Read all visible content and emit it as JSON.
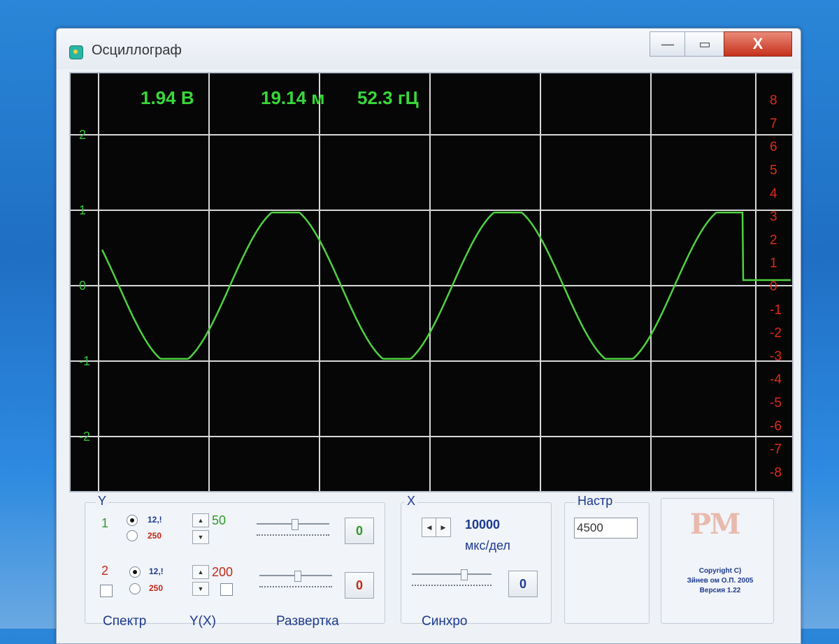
{
  "window": {
    "title": "Осциллограф",
    "min": "—",
    "max": "▭",
    "close": "X"
  },
  "readouts": {
    "voltage": "1.94 В",
    "period": "19.14 м",
    "frequency": "52.3 гЦ"
  },
  "axes": {
    "left_ticks": [
      "2",
      "1",
      "0",
      "-1",
      "-2"
    ],
    "right_ticks": [
      "8",
      "7",
      "6",
      "5",
      "4",
      "3",
      "2",
      "1",
      "0",
      "-1",
      "-2",
      "-3",
      "-4",
      "-5",
      "-6",
      "-7",
      "-8"
    ],
    "left_color": "#36c23a",
    "right_color": "#e22a1a"
  },
  "trace": {
    "color": "#4fd240",
    "amplitude": 1.0,
    "frequency_hz": 52.3
  },
  "controls": {
    "y": {
      "title": "Y",
      "ch1": {
        "label": "1",
        "range_a": "12,!",
        "range_b": "250",
        "value": "50",
        "offset": "0"
      },
      "ch2": {
        "label": "2",
        "range_a": "12,!",
        "range_b": "250",
        "value": "200",
        "offset": "0"
      }
    },
    "x": {
      "title": "X",
      "value": "10000",
      "unit": "мкс/дел",
      "offset": "0"
    },
    "settings": {
      "title": "Настр",
      "value": "4500"
    },
    "logo": "PM",
    "copyright": [
      "Copyright C)",
      "Зйнев ом О.П. 2005",
      "Версия 1.22"
    ],
    "tabs": [
      "Спектр",
      "Y(X)",
      "Развертка",
      "Синхро"
    ]
  }
}
